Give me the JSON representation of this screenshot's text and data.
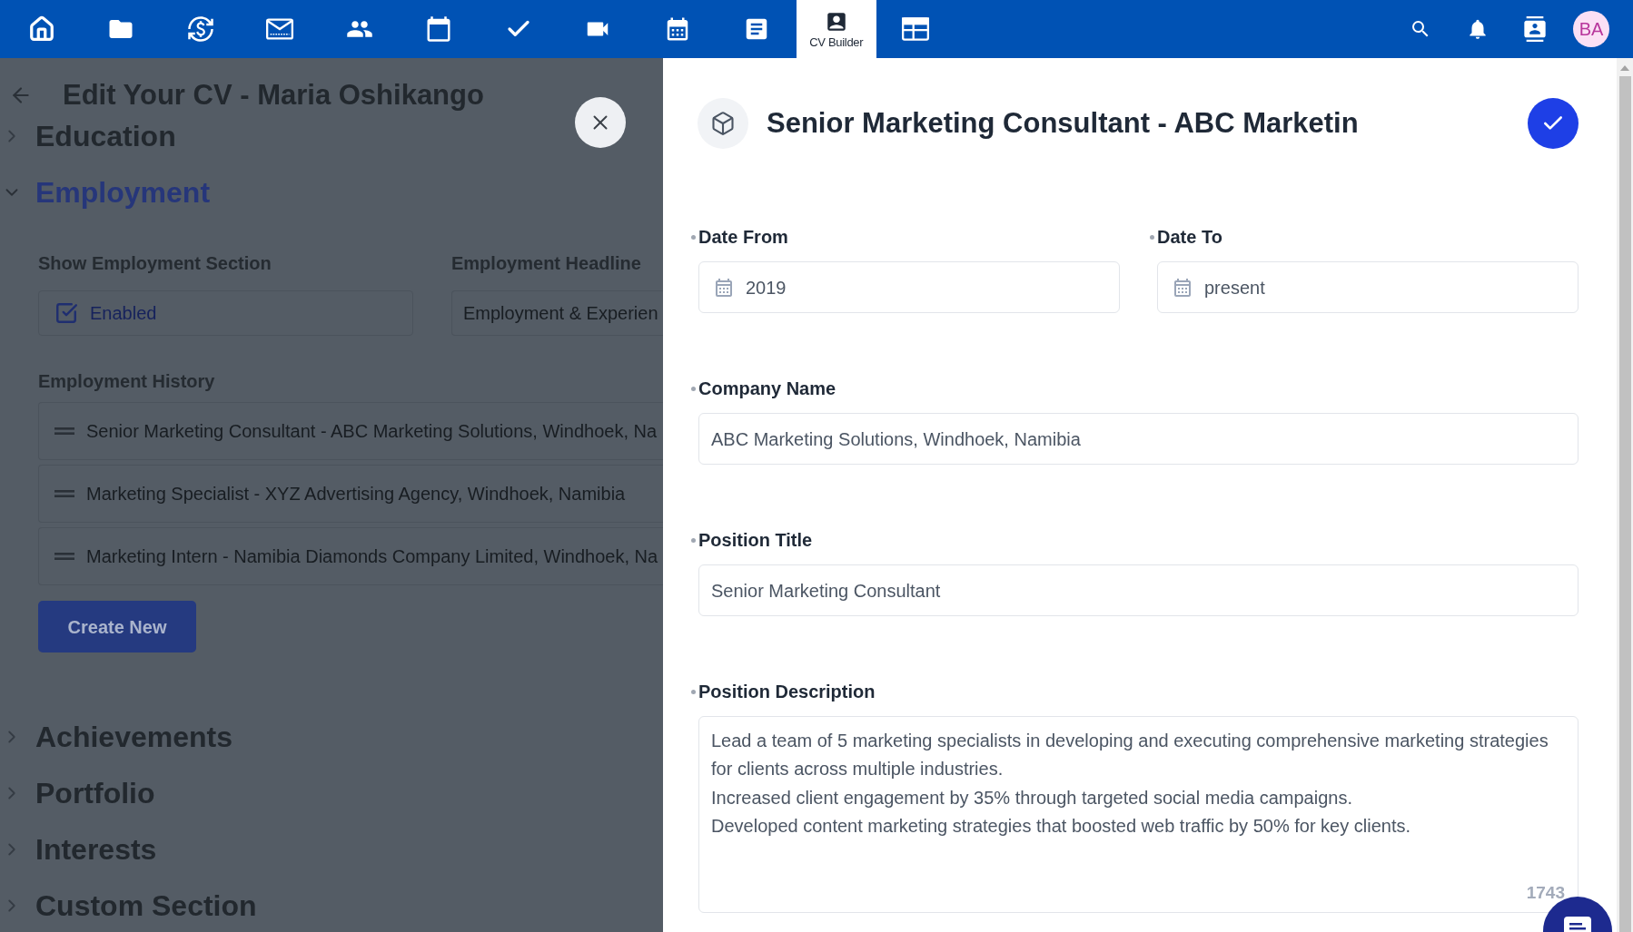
{
  "top_nav": {
    "items": [
      {
        "selected": false
      },
      {
        "selected": false
      },
      {
        "selected": false
      },
      {
        "selected": false
      },
      {
        "selected": false
      },
      {
        "selected": false
      },
      {
        "selected": false
      },
      {
        "selected": false
      },
      {
        "selected": false
      },
      {
        "selected": false
      },
      {
        "label": "CV Builder",
        "selected": true
      },
      {
        "selected": false
      }
    ],
    "avatar": {
      "initials": "BA"
    }
  },
  "editor": {
    "title": "Edit Your CV - Maria Oshikango",
    "sections": [
      {
        "title": "Education",
        "expanded": false
      },
      {
        "title": "Employment",
        "expanded": true,
        "show_section": {
          "label": "Show Employment Section",
          "option": "Enabled",
          "checked": true
        },
        "headline": {
          "label": "Employment Headline",
          "value": "Employment & Experien"
        },
        "history": {
          "label": "Employment History",
          "items": [
            "Senior Marketing Consultant - ABC Marketing Solutions, Windhoek, Na",
            "Marketing Specialist - XYZ Advertising Agency, Windhoek, Namibia",
            "Marketing Intern - Namibia Diamonds Company Limited, Windhoek, Na"
          ]
        },
        "create_button": "Create New"
      },
      {
        "title": "Achievements",
        "expanded": false
      },
      {
        "title": "Portfolio",
        "expanded": false
      },
      {
        "title": "Interests",
        "expanded": false
      },
      {
        "title": "Custom Section",
        "expanded": false
      }
    ]
  },
  "drawer": {
    "title": "Senior Marketing Consultant - ABC Marketin",
    "fields": [
      {
        "kind": "date",
        "label": "Date From",
        "required": true,
        "value": "2019"
      },
      {
        "kind": "date",
        "label": "Date To",
        "required": true,
        "value": "present"
      },
      {
        "kind": "text",
        "label": "Company Name",
        "required": true,
        "value": "ABC Marketing Solutions, Windhoek, Namibia"
      },
      {
        "kind": "text",
        "label": "Position Title",
        "required": true,
        "value": "Senior Marketing Consultant"
      },
      {
        "kind": "textarea",
        "label": "Position Description",
        "required": true,
        "value": "Lead a team of 5 marketing specialists in developing and executing comprehensive marketing strategies for clients across multiple industries.\nIncreased client engagement by 35% through targeted social media campaigns.\nDeveloped content marketing strategies that boosted web traffic by 50% for key clients.",
        "counter": "1743"
      }
    ]
  }
}
